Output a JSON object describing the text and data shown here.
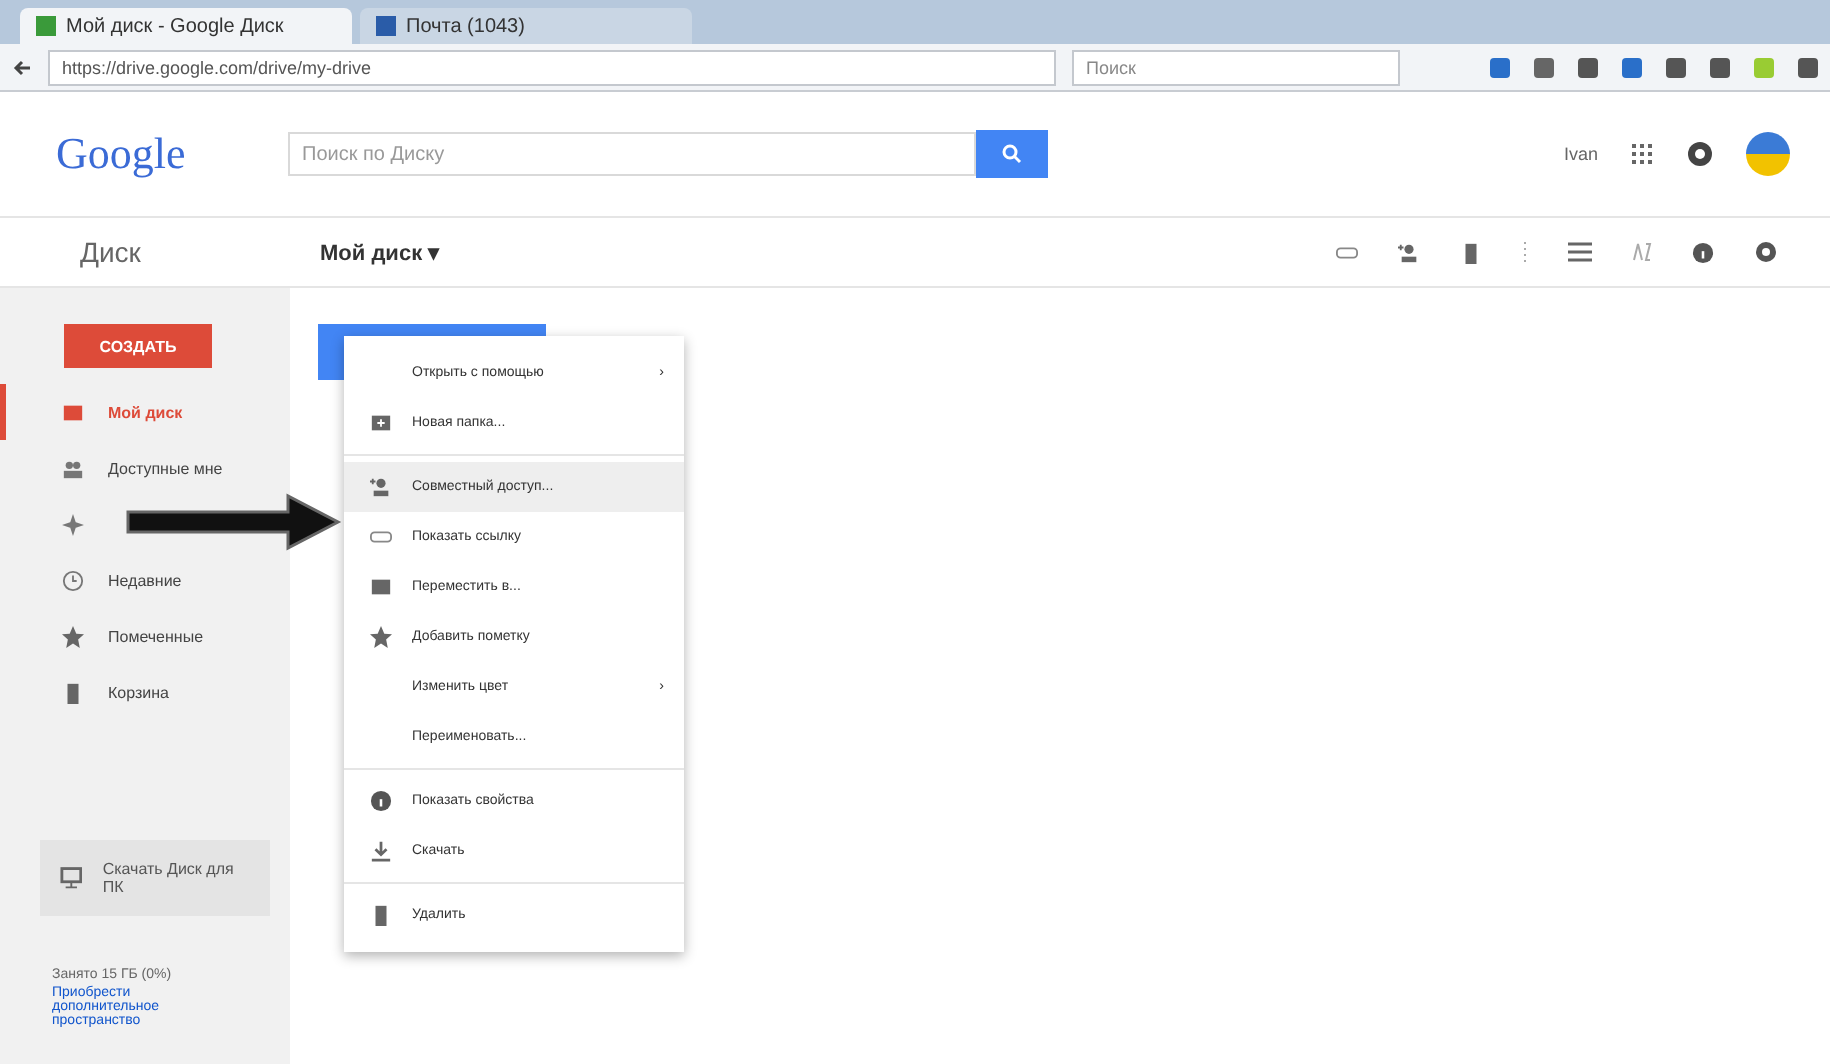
{
  "browser": {
    "tabs": [
      {
        "label": "Мой диск - Google Диск",
        "selected": true
      },
      {
        "label": "Почта (1043)",
        "selected": false
      }
    ],
    "url": "https://drive.google.com/drive/my-drive",
    "search_placeholder": "Поиск"
  },
  "header": {
    "logo": "Google",
    "search_placeholder": "Поиск по Диску",
    "user": "Ivan"
  },
  "toolbar": {
    "app_title": "Диск",
    "location": "Мой диск",
    "location_caret": "▾"
  },
  "sidebar": {
    "create_button": "СОЗДАТЬ",
    "items": [
      {
        "label": "Мой диск",
        "kind": "drive",
        "selected": true
      },
      {
        "label": "Доступные мне",
        "kind": "shared",
        "selected": false
      },
      {
        "kind": "photos",
        "selected": false
      },
      {
        "label": "Недавние",
        "kind": "recent",
        "selected": false
      },
      {
        "label": "Помеченные",
        "kind": "starred",
        "selected": false
      },
      {
        "label": "Корзина",
        "kind": "trash",
        "selected": false
      }
    ],
    "download_promo": "Скачать Диск для ПК",
    "storage": "Занято 15 ГБ (0%)",
    "buy_link": "Приобрести дополнительное пространство"
  },
  "context_menu": {
    "sections": [
      [
        {
          "label": "Открыть с помощью",
          "kind": "open",
          "submenu": true,
          "selected": false
        },
        {
          "label": "Новая папка...",
          "kind": "new-folder",
          "submenu": false,
          "selected": false
        }
      ],
      [
        {
          "label": "Совместный доступ...",
          "kind": "share",
          "submenu": false,
          "selected": true
        },
        {
          "label": "Показать ссылку",
          "kind": "link",
          "submenu": false,
          "selected": false
        },
        {
          "label": "Переместить в...",
          "kind": "move",
          "submenu": false,
          "selected": false
        },
        {
          "label": "Добавить пометку",
          "kind": "star",
          "submenu": false,
          "selected": false
        },
        {
          "label": "Изменить цвет",
          "kind": "color",
          "submenu": true,
          "selected": false
        },
        {
          "label": "Переименовать...",
          "kind": "rename",
          "submenu": false,
          "selected": false
        }
      ],
      [
        {
          "label": "Показать свойства",
          "kind": "details",
          "submenu": false,
          "selected": false
        },
        {
          "label": "Скачать",
          "kind": "download",
          "submenu": false,
          "selected": false
        }
      ],
      [
        {
          "label": "Удалить",
          "kind": "remove",
          "submenu": false,
          "selected": false
        }
      ]
    ],
    "submenu_marker": "›"
  }
}
